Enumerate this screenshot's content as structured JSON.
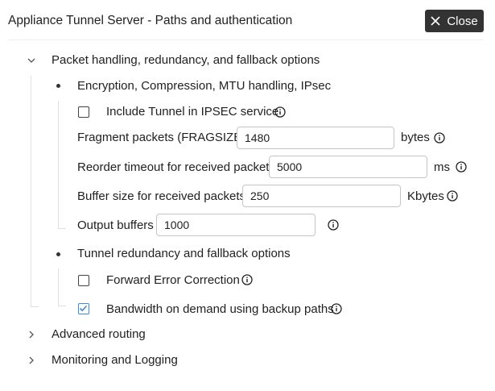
{
  "dialog": {
    "title": "Appliance Tunnel Server - Paths and authentication",
    "close_label": "Close"
  },
  "sections": {
    "packet_handling": {
      "title": "Packet handling, redundancy, and fallback options",
      "expanded": true,
      "encryption": {
        "title": "Encryption, Compression, MTU handling, IPsec",
        "include_ipsec": {
          "label": "Include Tunnel in IPSEC service",
          "checked": false
        },
        "fragsize": {
          "label": "Fragment packets (FRAGSIZE)",
          "value": "1480",
          "unit": "bytes"
        },
        "reorder_timeout": {
          "label": "Reorder timeout for received packets",
          "value": "5000",
          "unit": "ms"
        },
        "buffer_size": {
          "label": "Buffer size for received packets",
          "value": "250",
          "unit": "Kbytes"
        },
        "output_buffers": {
          "label": "Output buffers",
          "value": "1000"
        }
      },
      "redundancy": {
        "title": "Tunnel redundancy and fallback options",
        "fec": {
          "label": "Forward Error Correction",
          "checked": false
        },
        "bandwidth_on_demand": {
          "label": "Bandwidth on demand using backup paths",
          "checked": true
        }
      }
    },
    "advanced_routing": {
      "title": "Advanced routing",
      "expanded": false
    },
    "monitoring": {
      "title": "Monitoring and Logging",
      "expanded": false
    }
  },
  "colors": {
    "accent": "#3d8bd9",
    "close_bg": "#333333",
    "info_icon": "#212121"
  }
}
